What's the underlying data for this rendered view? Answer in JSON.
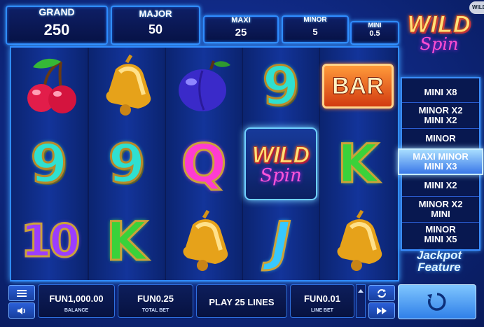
{
  "jackpots": [
    {
      "label": "GRAND",
      "value": "250"
    },
    {
      "label": "MAJOR",
      "value": "50"
    },
    {
      "label": "MAXI",
      "value": "25"
    },
    {
      "label": "MINOR",
      "value": "5"
    },
    {
      "label": "MINI",
      "value": "0.5"
    }
  ],
  "logo": {
    "line1": "WILD",
    "line2": "Spin"
  },
  "corner_tab": "WILD",
  "reels": [
    [
      "cherry",
      "9",
      "10"
    ],
    [
      "bell",
      "9",
      "K"
    ],
    [
      "plum",
      "Q",
      "bell"
    ],
    [
      "9",
      "wild",
      "J"
    ],
    [
      "bar",
      "K",
      "bell"
    ]
  ],
  "symbols": {
    "bar": "BAR",
    "wild_line1": "WILD",
    "wild_line2": "Spin"
  },
  "feature_rows": [
    {
      "lines": [
        "MINI X8"
      ],
      "highlight": false
    },
    {
      "lines": [
        "MINOR X2",
        "MINI X2"
      ],
      "highlight": false
    },
    {
      "lines": [
        "MINOR"
      ],
      "highlight": false
    },
    {
      "lines": [
        "MAXI  MINOR",
        "MINI X3"
      ],
      "highlight": true
    },
    {
      "lines": [
        "MINI X2"
      ],
      "highlight": false
    },
    {
      "lines": [
        "MINOR X2",
        "MINI"
      ],
      "highlight": false
    },
    {
      "lines": [
        "MINOR",
        "MINI X5"
      ],
      "highlight": false
    }
  ],
  "feature_title": {
    "line1": "Jackpot",
    "line2": "Feature"
  },
  "controls": {
    "balance_value": "FUN1,000.00",
    "balance_label": "BALANCE",
    "total_bet_value": "FUN0.25",
    "total_bet_label": "TOTAL BET",
    "lines_label": "PLAY 25 LINES",
    "line_bet_value": "FUN0.01",
    "line_bet_label": "LINE BET"
  },
  "icons": {
    "menu": "menu-icon",
    "sound": "speaker-icon",
    "autoplay": "autoplay-icon",
    "turbo": "fast-forward-icon",
    "spin": "spin-icon"
  },
  "colors": {
    "accent": "#2f8cff",
    "background": "#102a86",
    "spin_button": "#4fa2f8"
  }
}
